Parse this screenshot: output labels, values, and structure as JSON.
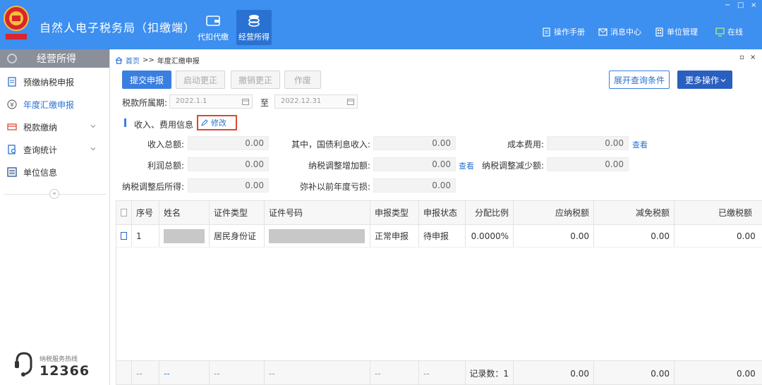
{
  "header": {
    "title": "自然人电子税务局（扣缴端）",
    "tabs": [
      {
        "label": "代扣代缴",
        "icon": "wallet-icon",
        "active": false
      },
      {
        "label": "经营所得",
        "icon": "coins-icon",
        "active": true
      }
    ],
    "links": [
      {
        "label": "操作手册",
        "icon": "manual-icon"
      },
      {
        "label": "消息中心",
        "icon": "mail-icon"
      },
      {
        "label": "单位管理",
        "icon": "building-icon"
      },
      {
        "label": "在线",
        "icon": "monitor-icon"
      }
    ],
    "window_controls": [
      "−",
      "□",
      "×"
    ]
  },
  "sidebar": {
    "title": "经营所得",
    "items": [
      {
        "label": "预缴纳税申报",
        "icon": "form-icon",
        "active": false,
        "expandable": false
      },
      {
        "label": "年度汇缴申报",
        "icon": "yen-icon",
        "active": true,
        "expandable": false
      },
      {
        "label": "税款缴纳",
        "icon": "payment-icon",
        "active": false,
        "expandable": true
      },
      {
        "label": "查询统计",
        "icon": "query-icon",
        "active": false,
        "expandable": true
      },
      {
        "label": "单位信息",
        "icon": "list-icon",
        "active": false,
        "expandable": false
      }
    ],
    "collapse_glyph": "«",
    "hotline_caption": "纳税服务热线",
    "hotline_number": "12366"
  },
  "breadcrumb": {
    "home": "首页",
    "separator": ">>",
    "current": "年度汇缴申报"
  },
  "main_controls": [
    "▫",
    "×"
  ],
  "toolbar": {
    "submit": "提交申报",
    "start_correction": "启动更正",
    "cancel_correction": "撤销更正",
    "void": "作废",
    "expand_query": "展开查询条件",
    "more_ops": "更多操作"
  },
  "period": {
    "label": "税款所属期:",
    "start": "2022.1.1",
    "to": "至",
    "end": "2022.12.31"
  },
  "section": {
    "title": "收入、费用信息",
    "edit_label": "修改"
  },
  "fields": {
    "total_income": {
      "label": "收入总额:",
      "value": "0.00"
    },
    "bond_interest": {
      "label": "其中，国债利息收入:",
      "value": "0.00"
    },
    "cost": {
      "label": "成本费用:",
      "value": "0.00"
    },
    "total_profit": {
      "label": "利润总额:",
      "value": "0.00"
    },
    "adj_increase": {
      "label": "纳税调整增加额:",
      "value": "0.00"
    },
    "adj_decrease": {
      "label": "纳税调整减少额:",
      "value": "0.00"
    },
    "adjusted_income": {
      "label": "纳税调整后所得:",
      "value": "0.00"
    },
    "prior_loss": {
      "label": "弥补以前年度亏损:",
      "value": "0.00"
    },
    "view_label": "查看"
  },
  "table": {
    "columns": [
      "序号",
      "姓名",
      "证件类型",
      "证件号码",
      "申报类型",
      "申报状态",
      "分配比例",
      "应纳税额",
      "减免税额",
      "已缴税额"
    ],
    "rows": [
      {
        "seq": "1",
        "id_type": "居民身份证",
        "decl_type": "正常申报",
        "status": "待申报",
        "ratio": "0.0000%",
        "tax_payable": "0.00",
        "tax_relief": "0.00",
        "tax_paid": "0.00"
      }
    ],
    "footer": {
      "dash": "--",
      "record_count": "记录数：1",
      "tax_payable": "0.00",
      "tax_relief": "0.00",
      "tax_paid": "0.00"
    }
  },
  "colors": {
    "header_bg": "#3d8ff0",
    "primary": "#3a7fe0",
    "highlight_border": "#e0462e",
    "sidebar_head": "#8a8f99"
  }
}
